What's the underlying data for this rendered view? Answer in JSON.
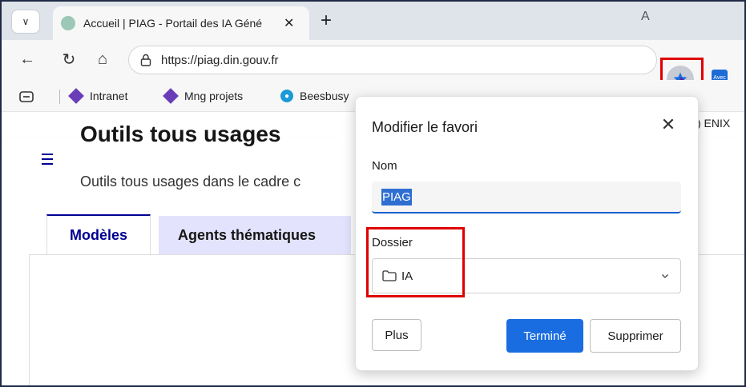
{
  "browser": {
    "tab": {
      "title": "Accueil | PIAG - Portail des IA Géné",
      "close_glyph": "✕"
    },
    "tab_menu_glyph": "∨",
    "new_tab_glyph": "+",
    "address": {
      "url": "https://piag.din.gouv.fr"
    },
    "nav": {
      "back": "←",
      "reload": "↻",
      "home": "⌂"
    },
    "read_aloud_glyph": "A",
    "extension_label": "Avec",
    "bookmarks": [
      {
        "label": "Intranet",
        "icon": "diamond-icon"
      },
      {
        "label": "Mng projets",
        "icon": "diamond-icon"
      },
      {
        "label": "Beesbusy",
        "icon": "bee-icon"
      }
    ],
    "bookmark_overflow": ") ENIX"
  },
  "page": {
    "tabs": [
      {
        "label": "Modèles",
        "active": true
      },
      {
        "label": "Agents thématiques",
        "active": false
      }
    ],
    "heading": "Outils tous usages",
    "paragraph": "Outils tous usages dans le cadre c"
  },
  "dialog": {
    "title": "Modifier le favori",
    "close_glyph": "✕",
    "name_label": "Nom",
    "name_value": "PIAG",
    "folder_label": "Dossier",
    "folder_value": "IA",
    "buttons": {
      "more": "Plus",
      "done": "Terminé",
      "delete": "Supprimer"
    }
  },
  "colors": {
    "accent_blue": "#1a6de0",
    "highlight_red": "#e00000",
    "dsfr_blue": "#000091",
    "tab_inactive_bg": "#e3e3fd"
  }
}
